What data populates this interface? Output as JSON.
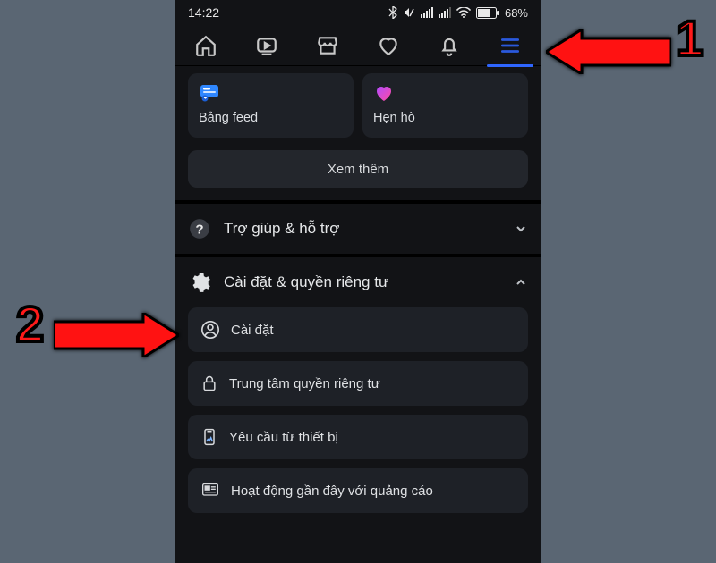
{
  "status": {
    "time": "14:22",
    "battery": "68%"
  },
  "tabs": [
    "home",
    "watch",
    "marketplace",
    "dating",
    "notifications",
    "menu"
  ],
  "shortcuts": {
    "feed": {
      "label": "Bảng feed"
    },
    "dating": {
      "label": "Hẹn hò"
    }
  },
  "see_more": "Xem thêm",
  "sections": {
    "help": {
      "label": "Trợ giúp & hỗ trợ",
      "expanded": false
    },
    "privacy": {
      "label": "Cài đặt & quyền riêng tư",
      "expanded": true,
      "items": [
        {
          "key": "settings",
          "label": "Cài đặt"
        },
        {
          "key": "privacy_center",
          "label": "Trung tâm quyền riêng tư"
        },
        {
          "key": "device_req",
          "label": "Yêu cầu từ thiết bị"
        },
        {
          "key": "ad_activity",
          "label": "Hoạt động gần đây với quảng cáo"
        }
      ]
    }
  },
  "annotations": {
    "1": "1",
    "2": "2"
  }
}
